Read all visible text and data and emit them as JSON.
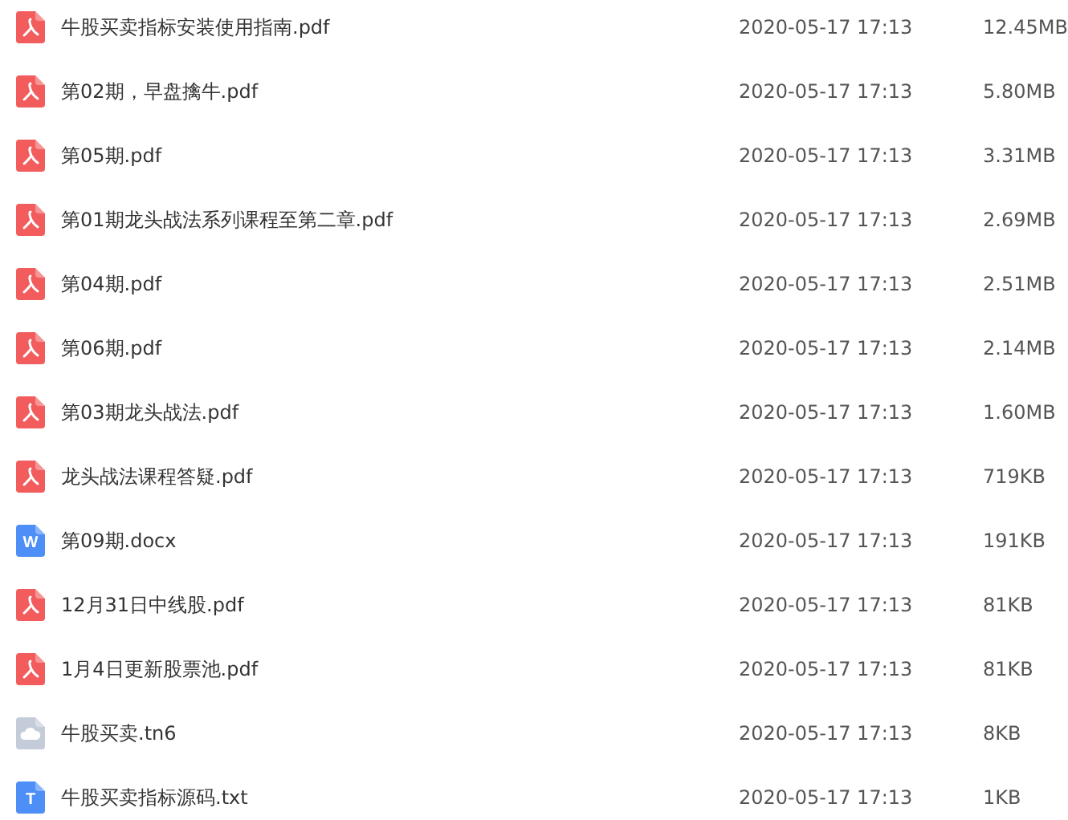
{
  "files": [
    {
      "kind": "pdf",
      "name": "牛股买卖指标安装使用指南.pdf",
      "modified": "2020-05-17 17:13",
      "size": "12.45MB"
    },
    {
      "kind": "pdf",
      "name": "第02期，早盘擒牛.pdf",
      "modified": "2020-05-17 17:13",
      "size": "5.80MB"
    },
    {
      "kind": "pdf",
      "name": "第05期.pdf",
      "modified": "2020-05-17 17:13",
      "size": "3.31MB"
    },
    {
      "kind": "pdf",
      "name": "第01期龙头战法系列课程至第二章.pdf",
      "modified": "2020-05-17 17:13",
      "size": "2.69MB"
    },
    {
      "kind": "pdf",
      "name": "第04期.pdf",
      "modified": "2020-05-17 17:13",
      "size": "2.51MB"
    },
    {
      "kind": "pdf",
      "name": "第06期.pdf",
      "modified": "2020-05-17 17:13",
      "size": "2.14MB"
    },
    {
      "kind": "pdf",
      "name": "第03期龙头战法.pdf",
      "modified": "2020-05-17 17:13",
      "size": "1.60MB"
    },
    {
      "kind": "pdf",
      "name": "龙头战法课程答疑.pdf",
      "modified": "2020-05-17 17:13",
      "size": "719KB"
    },
    {
      "kind": "word",
      "icon_letter": "W",
      "name": "第09期.docx",
      "modified": "2020-05-17 17:13",
      "size": "191KB"
    },
    {
      "kind": "pdf",
      "name": "12月31日中线股.pdf",
      "modified": "2020-05-17 17:13",
      "size": "81KB"
    },
    {
      "kind": "pdf",
      "name": "1月4日更新股票池.pdf",
      "modified": "2020-05-17 17:13",
      "size": "81KB"
    },
    {
      "kind": "cloud",
      "name": "牛股买卖.tn6",
      "modified": "2020-05-17 17:13",
      "size": "8KB"
    },
    {
      "kind": "text",
      "icon_letter": "T",
      "name": "牛股买卖指标源码.txt",
      "modified": "2020-05-17 17:13",
      "size": "1KB"
    }
  ]
}
